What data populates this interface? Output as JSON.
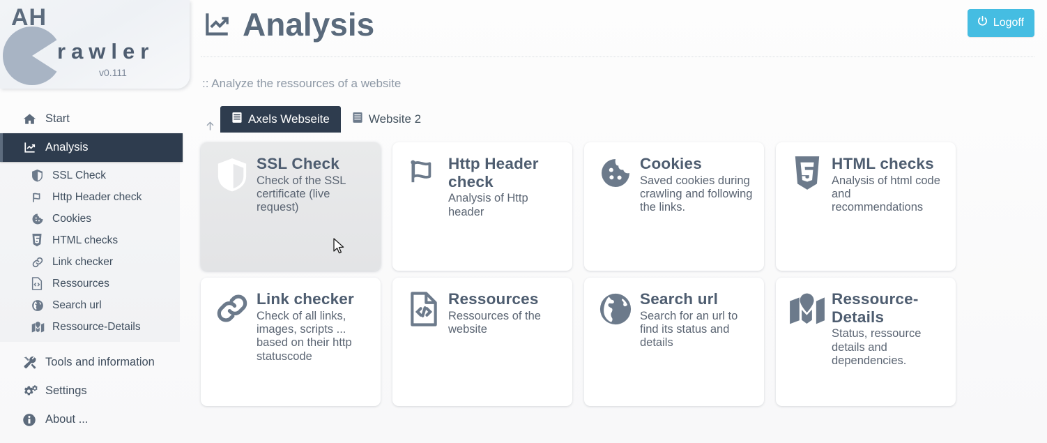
{
  "brand": {
    "name_top": "AH",
    "name_bottom": "rawler",
    "version": "v0.111",
    "logo_icon": "pacman-logo-icon"
  },
  "header": {
    "title": "Analysis",
    "title_icon": "chart-line-icon",
    "logoff_label": "Logoff",
    "logoff_icon": "power-icon",
    "logoff_color": "#45bde2"
  },
  "subtitle": ":: Analyze the ressources of a website",
  "sidebar": {
    "active_color": "#2e3c4e",
    "items": [
      {
        "label": "Start",
        "icon": "home-icon",
        "active": false
      },
      {
        "label": "Analysis",
        "icon": "chart-line-icon",
        "active": true
      },
      {
        "label": "Tools and information",
        "icon": "tools-icon",
        "active": false
      },
      {
        "label": "Settings",
        "icon": "gears-icon",
        "active": false
      },
      {
        "label": "About ...",
        "icon": "info-icon",
        "active": false
      }
    ],
    "sub_items": [
      {
        "label": "SSL Check",
        "icon": "shield-icon"
      },
      {
        "label": "Http Header check",
        "icon": "flag-icon"
      },
      {
        "label": "Cookies",
        "icon": "cookie-icon"
      },
      {
        "label": "HTML checks",
        "icon": "html5-icon"
      },
      {
        "label": "Link checker",
        "icon": "link-icon"
      },
      {
        "label": "Ressources",
        "icon": "file-code-icon"
      },
      {
        "label": "Search url",
        "icon": "globe-icon"
      },
      {
        "label": "Ressource-Details",
        "icon": "map-icon"
      }
    ]
  },
  "tabs": {
    "up_arrow_icon": "arrow-up-icon",
    "items": [
      {
        "label": "Axels Webseite",
        "icon": "book-icon",
        "active": true
      },
      {
        "label": "Website 2",
        "icon": "book-icon",
        "active": false
      }
    ]
  },
  "cards": [
    {
      "title": "SSL Check",
      "description": "Check of the SSL certificate (live request)",
      "icon": "shield-icon",
      "hovered": true
    },
    {
      "title": "Http Header check",
      "description": "Analysis of Http header",
      "icon": "flag-icon",
      "hovered": false
    },
    {
      "title": "Cookies",
      "description": "Saved cookies during crawling and following the links.",
      "icon": "cookie-icon",
      "hovered": false
    },
    {
      "title": "HTML checks",
      "description": "Analysis of html code and recommendations",
      "icon": "html5-icon",
      "hovered": false
    },
    {
      "title": "Link checker",
      "description": "Check of all links, images, scripts ... based on their http statuscode",
      "icon": "link-icon",
      "hovered": false
    },
    {
      "title": "Ressources",
      "description": "Ressources of the website",
      "icon": "file-code-icon",
      "hovered": false
    },
    {
      "title": "Search url",
      "description": "Search for an url to find its status and details",
      "icon": "globe-icon",
      "hovered": false
    },
    {
      "title": "Ressource-Details",
      "description": "Status, ressource details and dependencies.",
      "icon": "map-icon",
      "hovered": false
    }
  ]
}
